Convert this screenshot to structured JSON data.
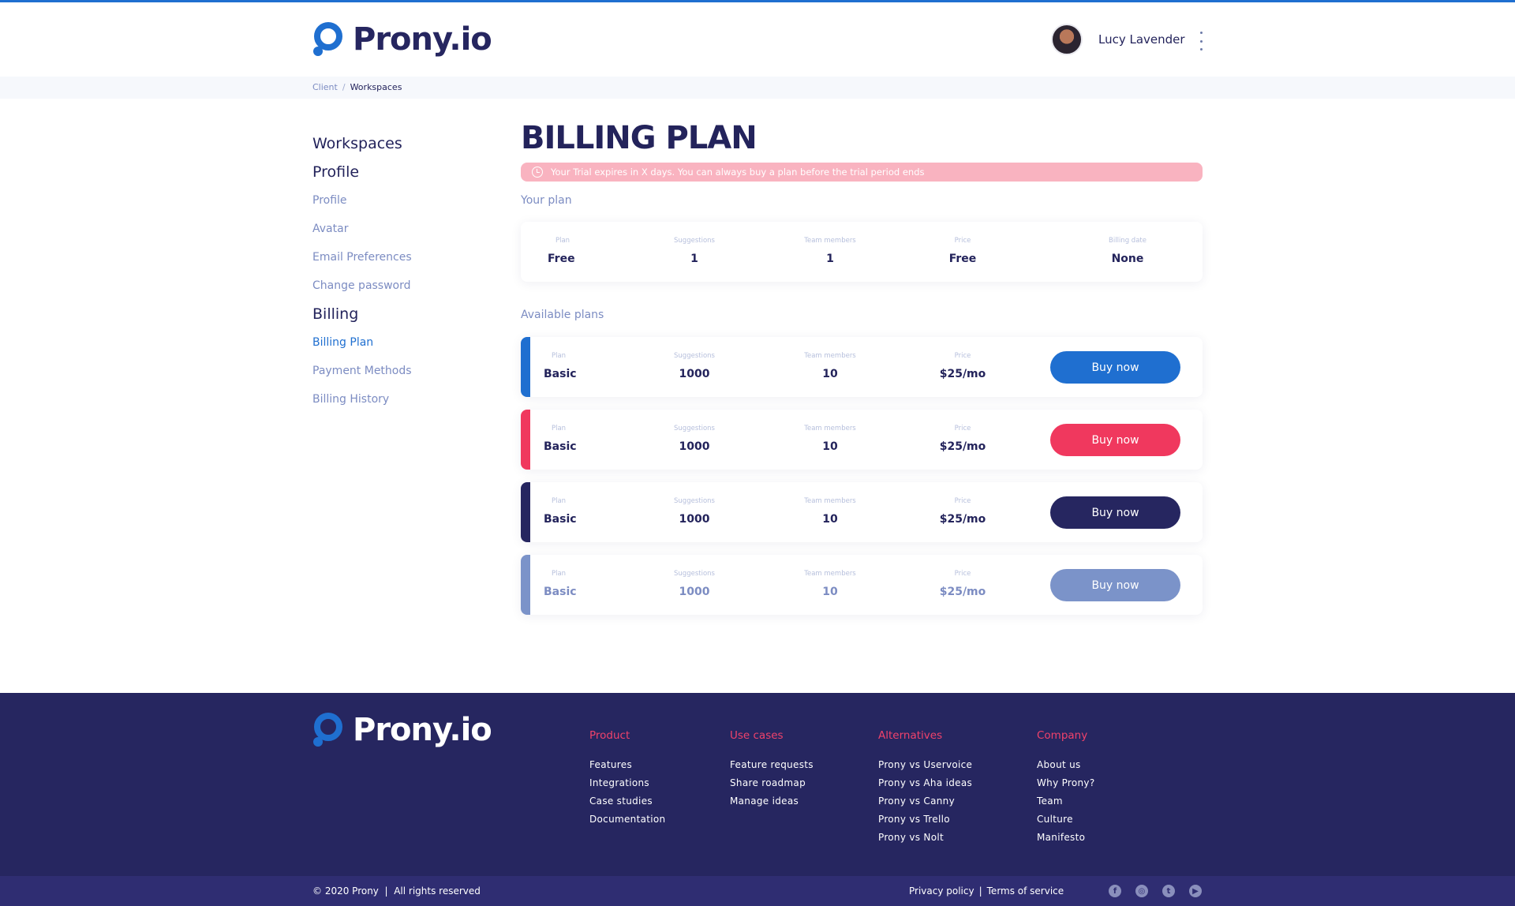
{
  "brand": {
    "name": "Prony.io",
    "accent": "#1f6fd0",
    "navy": "#23235b"
  },
  "header": {
    "user_name": "Lucy Lavender"
  },
  "breadcrumb": {
    "items": [
      "Client",
      "Workspaces"
    ],
    "separator": "/"
  },
  "sidebar": {
    "workspaces": "Workspaces",
    "profile_heading": "Profile",
    "profile_items": [
      "Profile",
      "Avatar",
      "Email Preferences",
      "Change password"
    ],
    "billing_heading": "Billing",
    "billing_items": [
      "Billing Plan",
      "Payment Methods",
      "Billing History"
    ],
    "active": "Billing Plan"
  },
  "main": {
    "title": "BILLING PLAN",
    "trial_notice": "Your Trial expires in X days. You can always buy a plan before the trial period ends",
    "your_plan_label": "Your plan",
    "available_label": "Available plans",
    "labels": {
      "plan": "Plan",
      "suggestions": "Suggestions",
      "team": "Team members",
      "price": "Price",
      "billing_date": "Billing date"
    },
    "your_plan": {
      "plan": "Free",
      "suggestions": "1",
      "team": "1",
      "price": "Free",
      "billing_date": "None"
    },
    "plans": [
      {
        "plan": "Basic",
        "suggestions": "1000",
        "team": "10",
        "price": "$25/mo",
        "button": "Buy now",
        "color": "#1f6fd0"
      },
      {
        "plan": "Basic",
        "suggestions": "1000",
        "team": "10",
        "price": "$25/mo",
        "button": "Buy now",
        "color": "#f0385e"
      },
      {
        "plan": "Basic",
        "suggestions": "1000",
        "team": "10",
        "price": "$25/mo",
        "button": "Buy now",
        "color": "#262660"
      },
      {
        "plan": "Basic",
        "suggestions": "1000",
        "team": "10",
        "price": "$25/mo",
        "button": "Buy now",
        "color": "#7b93c9"
      }
    ]
  },
  "footer": {
    "columns": [
      {
        "title": "Product",
        "links": [
          "Features",
          "Integrations",
          "Case studies",
          "Documentation"
        ]
      },
      {
        "title": "Use cases",
        "links": [
          "Feature requests",
          "Share roadmap",
          "Manage ideas"
        ]
      },
      {
        "title": "Alternatives",
        "links": [
          "Prony vs Uservoice",
          "Prony vs Aha ideas",
          "Prony vs Canny",
          "Prony vs Trello",
          "Prony vs Nolt"
        ]
      },
      {
        "title": "Company",
        "links": [
          "About us",
          "Why Prony?",
          "Team",
          "Culture",
          "Manifesto"
        ]
      }
    ],
    "copyright": "© 2020 Prony  |  All rights reserved",
    "privacy": "Privacy policy",
    "terms": "Terms of service",
    "social_icons": [
      "facebook-icon",
      "instagram-icon",
      "twitter-icon",
      "youtube-icon"
    ]
  }
}
